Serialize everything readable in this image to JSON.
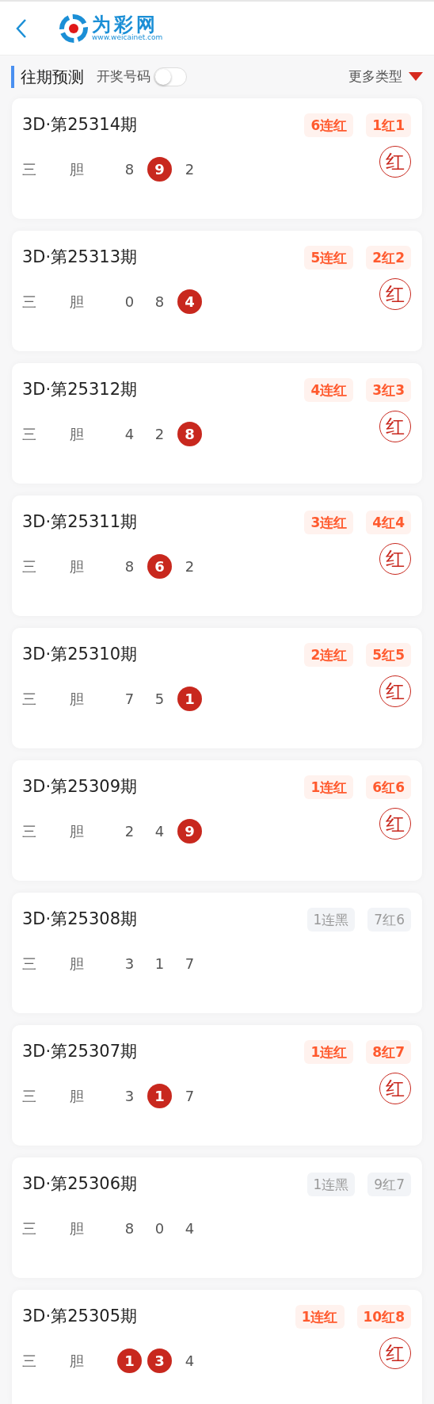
{
  "header": {
    "logo_name": "为彩网",
    "logo_url": "www.weicainet.com"
  },
  "section": {
    "title": "往期预测",
    "toggle": {
      "label": "开奖号码",
      "on": false
    },
    "more": "更多类型"
  },
  "cards": [
    {
      "title": "3D·第25314期",
      "tags": [
        {
          "text": "6连红",
          "kind": "red"
        },
        {
          "text": "1红1",
          "kind": "red"
        }
      ],
      "labels": [
        "三",
        "胆"
      ],
      "numbers": [
        {
          "text": "8",
          "hit": false
        },
        {
          "text": "9",
          "hit": true
        },
        {
          "text": "2",
          "hit": false
        }
      ],
      "result": "红"
    },
    {
      "title": "3D·第25313期",
      "tags": [
        {
          "text": "5连红",
          "kind": "red"
        },
        {
          "text": "2红2",
          "kind": "red"
        }
      ],
      "labels": [
        "三",
        "胆"
      ],
      "numbers": [
        {
          "text": "0",
          "hit": false
        },
        {
          "text": "8",
          "hit": false
        },
        {
          "text": "4",
          "hit": true
        }
      ],
      "result": "红"
    },
    {
      "title": "3D·第25312期",
      "tags": [
        {
          "text": "4连红",
          "kind": "red"
        },
        {
          "text": "3红3",
          "kind": "red"
        }
      ],
      "labels": [
        "三",
        "胆"
      ],
      "numbers": [
        {
          "text": "4",
          "hit": false
        },
        {
          "text": "2",
          "hit": false
        },
        {
          "text": "8",
          "hit": true
        }
      ],
      "result": "红"
    },
    {
      "title": "3D·第25311期",
      "tags": [
        {
          "text": "3连红",
          "kind": "red"
        },
        {
          "text": "4红4",
          "kind": "red"
        }
      ],
      "labels": [
        "三",
        "胆"
      ],
      "numbers": [
        {
          "text": "8",
          "hit": false
        },
        {
          "text": "6",
          "hit": true
        },
        {
          "text": "2",
          "hit": false
        }
      ],
      "result": "红"
    },
    {
      "title": "3D·第25310期",
      "tags": [
        {
          "text": "2连红",
          "kind": "red"
        },
        {
          "text": "5红5",
          "kind": "red"
        }
      ],
      "labels": [
        "三",
        "胆"
      ],
      "numbers": [
        {
          "text": "7",
          "hit": false
        },
        {
          "text": "5",
          "hit": false
        },
        {
          "text": "1",
          "hit": true
        }
      ],
      "result": "红"
    },
    {
      "title": "3D·第25309期",
      "tags": [
        {
          "text": "1连红",
          "kind": "red"
        },
        {
          "text": "6红6",
          "kind": "red"
        }
      ],
      "labels": [
        "三",
        "胆"
      ],
      "numbers": [
        {
          "text": "2",
          "hit": false
        },
        {
          "text": "4",
          "hit": false
        },
        {
          "text": "9",
          "hit": true
        }
      ],
      "result": "红"
    },
    {
      "title": "3D·第25308期",
      "tags": [
        {
          "text": "1连黑",
          "kind": "black"
        },
        {
          "text": "7红6",
          "kind": "black"
        }
      ],
      "labels": [
        "三",
        "胆"
      ],
      "numbers": [
        {
          "text": "3",
          "hit": false
        },
        {
          "text": "1",
          "hit": false
        },
        {
          "text": "7",
          "hit": false
        }
      ]
    },
    {
      "title": "3D·第25307期",
      "tags": [
        {
          "text": "1连红",
          "kind": "red"
        },
        {
          "text": "8红7",
          "kind": "red"
        }
      ],
      "labels": [
        "三",
        "胆"
      ],
      "numbers": [
        {
          "text": "3",
          "hit": false
        },
        {
          "text": "1",
          "hit": true
        },
        {
          "text": "7",
          "hit": false
        }
      ],
      "result": "红"
    },
    {
      "title": "3D·第25306期",
      "tags": [
        {
          "text": "1连黑",
          "kind": "black"
        },
        {
          "text": "9红7",
          "kind": "black"
        }
      ],
      "labels": [
        "三",
        "胆"
      ],
      "numbers": [
        {
          "text": "8",
          "hit": false
        },
        {
          "text": "0",
          "hit": false
        },
        {
          "text": "4",
          "hit": false
        }
      ]
    },
    {
      "title": "3D·第25305期",
      "tags": [
        {
          "text": "1连红",
          "kind": "red"
        },
        {
          "text": "10红8",
          "kind": "red"
        }
      ],
      "labels": [
        "三",
        "胆"
      ],
      "numbers": [
        {
          "text": "1",
          "hit": true
        },
        {
          "text": "3",
          "hit": true
        },
        {
          "text": "4",
          "hit": false
        }
      ],
      "result": "红"
    }
  ]
}
